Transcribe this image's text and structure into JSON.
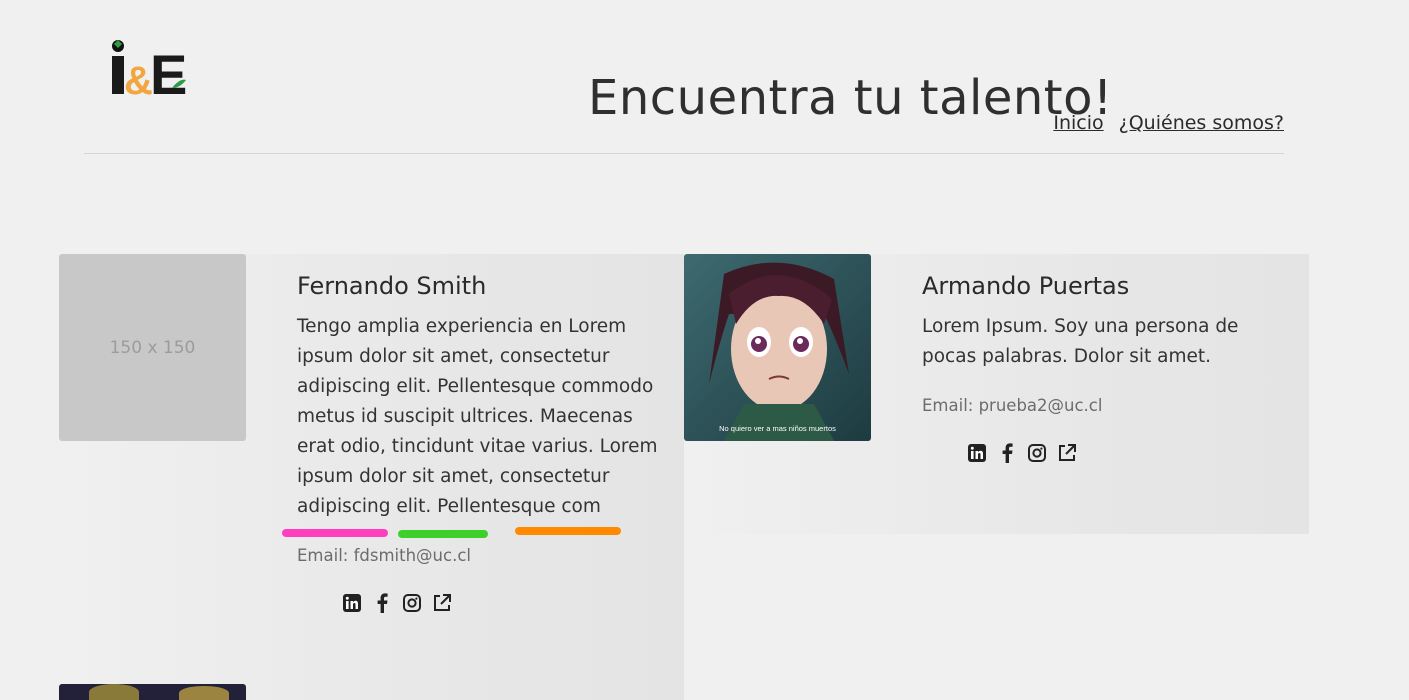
{
  "header": {
    "logo_text": "i&E",
    "title": "Encuentra tu talento!",
    "nav": [
      {
        "label": "Inicio"
      },
      {
        "label": "¿Quiénes somos?"
      }
    ]
  },
  "profiles": [
    {
      "name": "Fernando Smith",
      "photo_placeholder": "150 x 150",
      "bio": "Tengo amplia experiencia en Lorem ipsum dolor sit amet, consectetur adipiscing elit. Pellentesque commodo metus id suscipit ultrices. Maecenas erat odio, tincidunt vitae varius. Lorem ipsum dolor sit amet, consectetur adipiscing elit. Pellentesque com",
      "email": "Email: fdsmith@uc.cl",
      "social": [
        "linkedin-icon",
        "facebook-icon",
        "instagram-icon",
        "external-link-icon"
      ]
    },
    {
      "name": "Armando Puertas",
      "photo_caption": "No quiero ver a mas niños muertos",
      "bio": "Lorem Ipsum. Soy una persona de pocas palabras. Dolor sit amet.",
      "email": "Email: prueba2@uc.cl",
      "social": [
        "linkedin-icon",
        "facebook-icon",
        "instagram-icon",
        "external-link-icon"
      ]
    }
  ],
  "annotations": {
    "highlight_colors": [
      "#ff3fc0",
      "#3ecf2a",
      "#ff8a00"
    ]
  },
  "colors": {
    "background": "#f0f0f0",
    "text": "#2b2b2b",
    "email": "#6c6c6c"
  }
}
